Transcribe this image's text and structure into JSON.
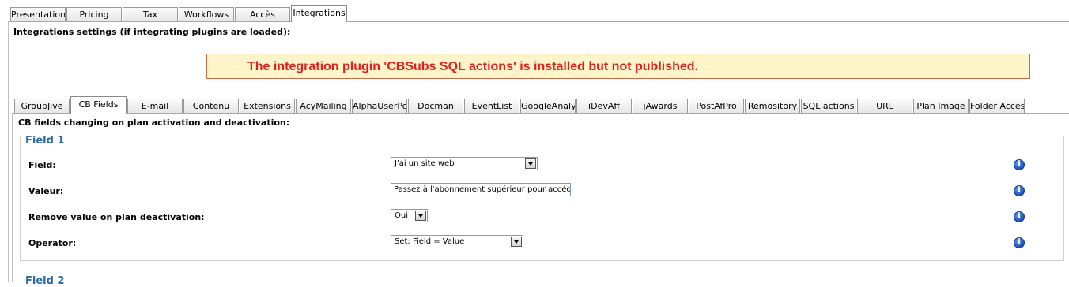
{
  "top_tabs": [
    "Presentation",
    "Pricing",
    "Tax",
    "Workflows",
    "Accès",
    "Integrations"
  ],
  "integrations_heading": "Integrations settings (if integrating plugins are loaded):",
  "notice": "The integration plugin 'CBSubs SQL actions' is installed but not published.",
  "sub_tabs": [
    "GroupJive",
    "CB Fields",
    "E-mail",
    "Contenu",
    "Extensions",
    "AcyMailing",
    "AlphaUserPoin",
    "Docman",
    "EventList",
    "GoogleAnalytic",
    "iDevAff",
    "jAwards",
    "PostAfPro",
    "Remository",
    "SQL actions",
    "URL",
    "Plan Image",
    "Folder Access"
  ],
  "cb_heading": "CB fields changing on plan activation and deactivation:",
  "field1": {
    "legend": "Field 1",
    "field_label": "Field:",
    "field_value": "J'ai un site web",
    "valeur_label": "Valeur:",
    "valeur_value": "Passez à l'abonnement supérieur pour accéde",
    "remove_label": "Remove value on plan deactivation:",
    "remove_value": "Oui",
    "operator_label": "Operator:",
    "operator_value": "Set: Field = Value"
  },
  "field2": {
    "legend": "Field 2"
  },
  "icons": {
    "info": "info-icon",
    "dropdown": "chevron-down-icon"
  },
  "colors": {
    "notice_text": "#e02020",
    "notice_bg": "#fdf5c9",
    "legend": "#2a6aa6"
  }
}
